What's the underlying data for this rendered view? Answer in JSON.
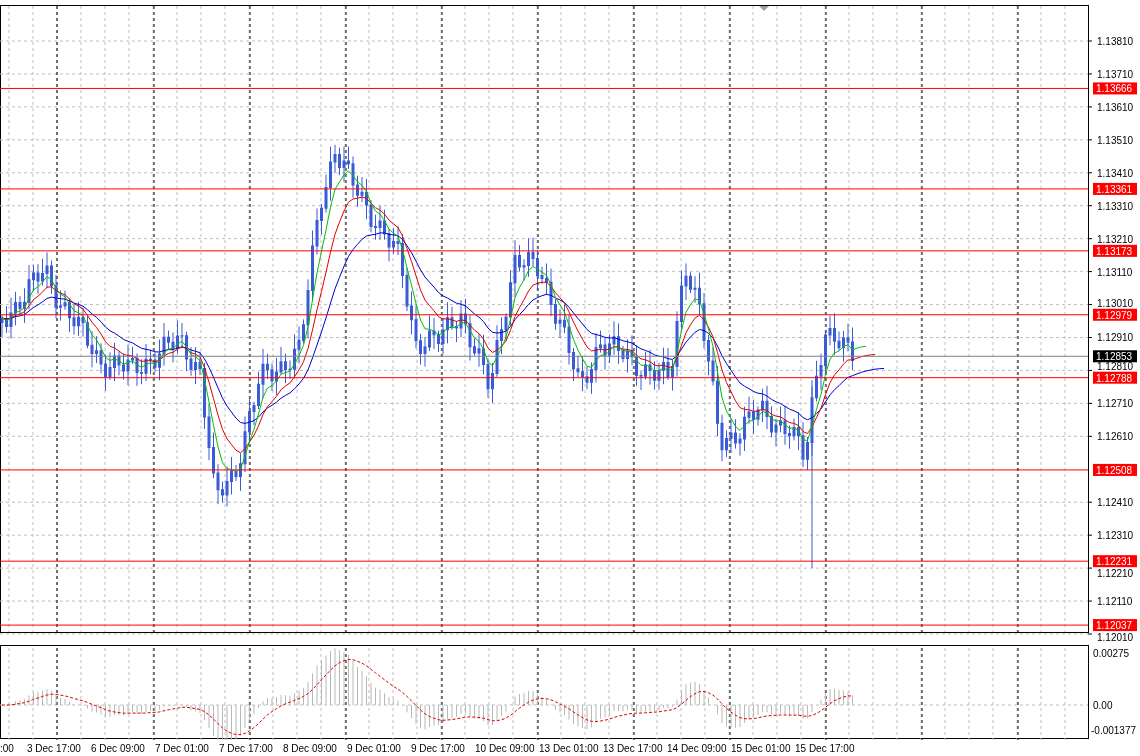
{
  "price_axis": {
    "ticks": [
      "1.13810",
      "1.13710",
      "1.13610",
      "1.13510",
      "1.13410",
      "1.13310",
      "1.13210",
      "1.13110",
      "1.13010",
      "1.12910",
      "1.12810",
      "1.12710",
      "1.12610",
      "1.12410",
      "1.12310",
      "1.12210",
      "1.12110",
      "1.12010"
    ]
  },
  "level_lines": [
    {
      "price": "1.13666"
    },
    {
      "price": "1.13361"
    },
    {
      "price": "1.13173"
    },
    {
      "price": "1.12979"
    },
    {
      "price": "1.12788"
    },
    {
      "price": "1.12508"
    },
    {
      "price": "1.12231"
    },
    {
      "price": "1.12037"
    }
  ],
  "current_price": "1.12853",
  "oscillator_axis": {
    "ticks": [
      "0.00275",
      "0.00",
      "-0.001377"
    ]
  },
  "time_axis": {
    "labels": [
      ":00",
      "3 Dec 17:00",
      "6 Dec 09:00",
      "7 Dec 01:00",
      "7 Dec 17:00",
      "8 Dec 09:00",
      "9 Dec 01:00",
      "9 Dec 17:00",
      "10 Dec 09:00",
      "13 Dec 01:00",
      "13 Dec 17:00",
      "14 Dec 09:00",
      "15 Dec 01:00",
      "15 Dec 17:00"
    ]
  }
}
